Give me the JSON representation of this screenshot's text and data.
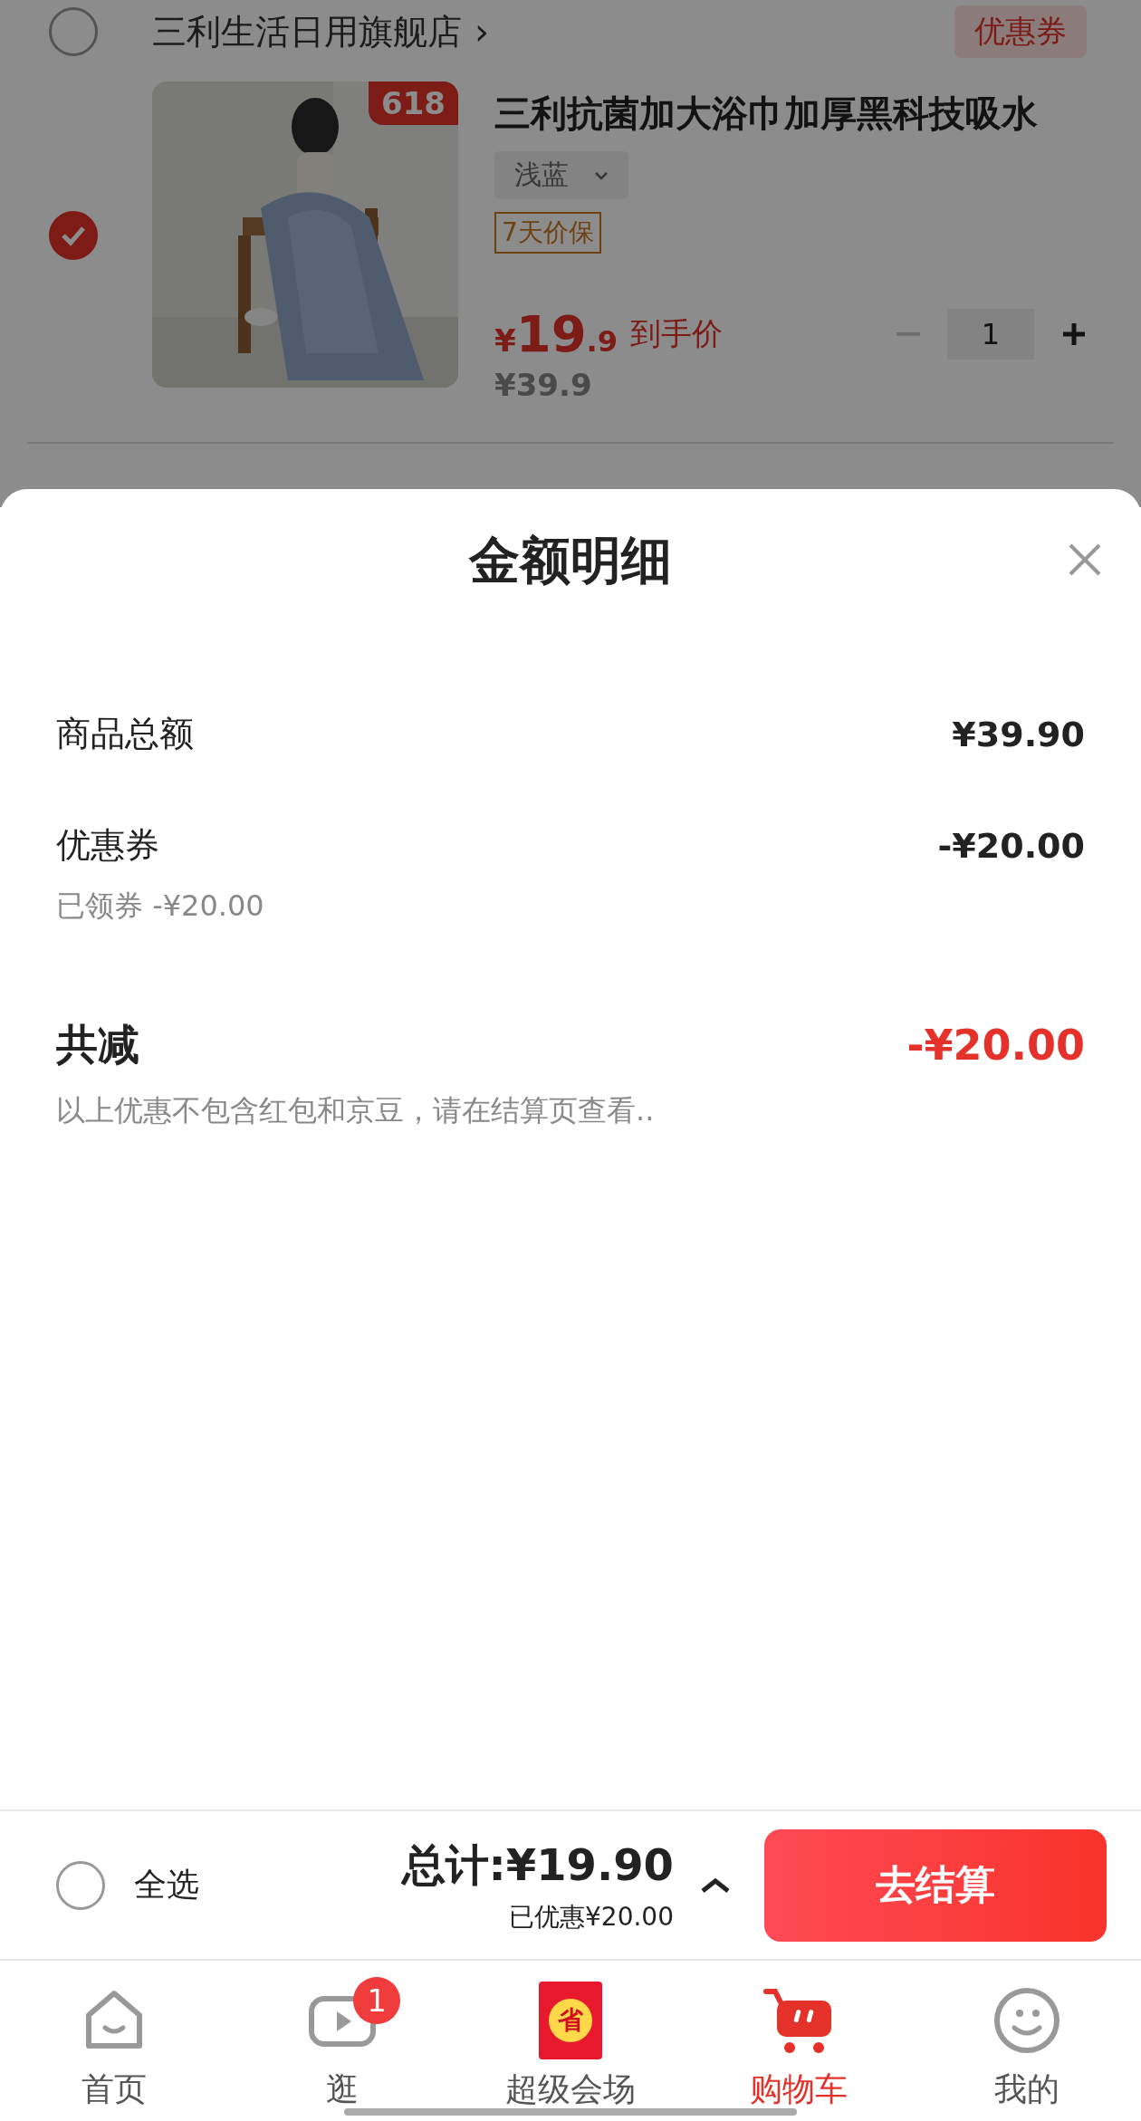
{
  "store": {
    "checked": false,
    "name": "三利生活日用旗舰店",
    "chevron": "›",
    "coupon": "优惠券"
  },
  "product": {
    "checked": true,
    "badge": "618",
    "title": "三利抗菌加大浴巾加厚黑科技吸水",
    "spec": "浅蓝",
    "tag": "7天价保",
    "currency": "¥",
    "price_int": "19",
    "price_dec": ".9",
    "price_label": "到手价",
    "original_price": "¥39.9",
    "quantity": "1"
  },
  "sheet": {
    "title": "金额明细",
    "rows": [
      {
        "kind": "line",
        "label": "商品总额",
        "value": "¥39.90"
      },
      {
        "kind": "line",
        "label": "优惠券",
        "value": "-¥20.00",
        "note": "已领券 -¥20.00"
      },
      {
        "kind": "total",
        "label": "共减",
        "value": "-¥20.00",
        "note": "以上优惠不包含红包和京豆，请在结算页查看.."
      }
    ]
  },
  "footer": {
    "select_all": {
      "label": "全选",
      "checked": false
    },
    "total": "总计:¥19.90",
    "saved": "已优惠¥20.00",
    "checkout": "去结算"
  },
  "tabs": [
    {
      "kind": "home",
      "label": "首页",
      "selected": false
    },
    {
      "kind": "video",
      "label": "逛",
      "selected": false,
      "badge": "1"
    },
    {
      "kind": "promo",
      "label": "超级会场",
      "selected": false,
      "icon_text": "省"
    },
    {
      "kind": "cart",
      "label": "购物车",
      "selected": true
    },
    {
      "kind": "profile",
      "label": "我的",
      "selected": false
    }
  ]
}
